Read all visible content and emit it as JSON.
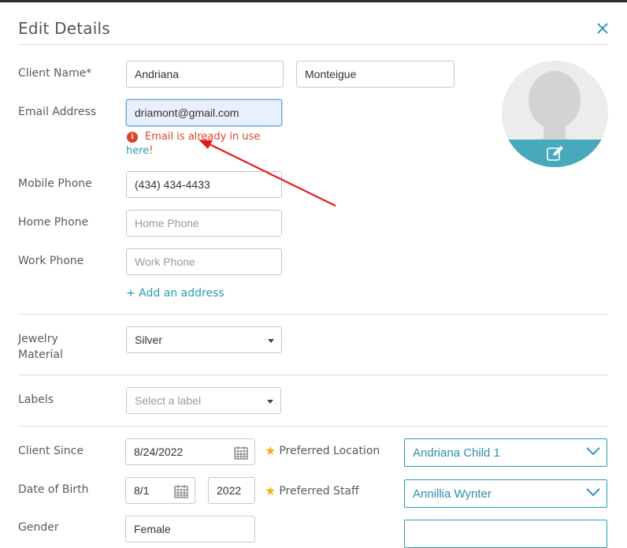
{
  "dialog": {
    "title": "Edit Details"
  },
  "form": {
    "client_name_label": "Client Name*",
    "first_name": "Andriana",
    "last_name": "Monteigue",
    "email_label": "Email Address",
    "email_value": "driamont@gmail.com",
    "email_error": "Email is already in use",
    "email_error_link": "here",
    "email_error_suffix": "!",
    "mobile_label": "Mobile Phone",
    "mobile_value": "(434) 434-4433",
    "home_label": "Home Phone",
    "home_placeholder": "Home Phone",
    "work_label": "Work Phone",
    "work_placeholder": "Work Phone",
    "add_address": "+ Add an address",
    "jewelry_label_1": "Jewelry",
    "jewelry_label_2": "Material",
    "jewelry_value": "Silver",
    "labels_label": "Labels",
    "labels_placeholder": "Select a label",
    "client_since_label": "Client Since",
    "client_since_value": "8/24/2022",
    "preferred_location_label": "Preferred Location",
    "preferred_location_value": "Andriana Child 1",
    "dob_label": "Date of Birth",
    "dob_day": "8/1",
    "dob_year": "2022",
    "preferred_staff_label": "Preferred Staff",
    "preferred_staff_value": "Annillia Wynter",
    "gender_label": "Gender",
    "gender_value": "Female"
  },
  "colors": {
    "accent": "#2b9bb5",
    "error": "#d9462c",
    "star": "#f2b01e",
    "avatar_band": "#48a9bd"
  },
  "icons": [
    "close-icon",
    "error-icon",
    "calendar-icon",
    "star-icon",
    "chevron-down-icon",
    "edit-icon",
    "avatar-silhouette"
  ]
}
